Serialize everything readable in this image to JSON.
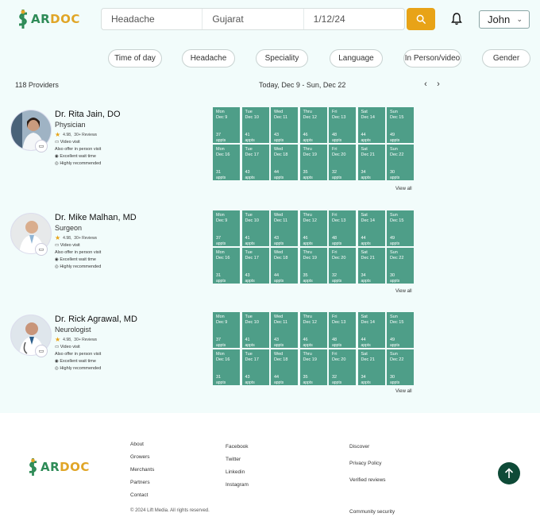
{
  "app": {
    "logo_text_part1": "S",
    "logo_text_part2": "AR",
    "logo_text_part3": "DOC",
    "brand_green": "#2e8b57",
    "brand_orange": "#e0a526"
  },
  "search": {
    "condition": "Headache",
    "location": "Gujarat",
    "date": "1/12/24",
    "button_color": "#e8a317"
  },
  "user": {
    "name": "John"
  },
  "filters": [
    "Time of day",
    "Headache",
    "Speciality",
    "Language",
    "In Person/video",
    "Gender"
  ],
  "results": {
    "count": "118 Providers",
    "date_range": "Today, Dec 9 - Sun, Dec 22",
    "prev": "‹",
    "next": "›"
  },
  "schedule": {
    "week1": [
      {
        "day": "Mon",
        "date": "Dec 9",
        "count": "37",
        "unit": "appts"
      },
      {
        "day": "Tue",
        "date": "Dec 10",
        "count": "41",
        "unit": "appts"
      },
      {
        "day": "Wed",
        "date": "Dec 11",
        "count": "43",
        "unit": "appts"
      },
      {
        "day": "Thru",
        "date": "Dec 12",
        "count": "46",
        "unit": "appts"
      },
      {
        "day": "Fri",
        "date": "Dec 13",
        "count": "48",
        "unit": "appts"
      },
      {
        "day": "Sat",
        "date": "Dec 14",
        "count": "44",
        "unit": "appts"
      },
      {
        "day": "Sun",
        "date": "Dec 15",
        "count": "49",
        "unit": "appts"
      }
    ],
    "week2": [
      {
        "day": "Mon",
        "date": "Dec 16",
        "count": "31",
        "unit": "appts"
      },
      {
        "day": "Tue",
        "date": "Dec 17",
        "count": "43",
        "unit": "appts"
      },
      {
        "day": "Wed",
        "date": "Dec 18",
        "count": "44",
        "unit": "appts"
      },
      {
        "day": "Thru",
        "date": "Dec 19",
        "count": "35",
        "unit": "appts"
      },
      {
        "day": "Fri",
        "date": "Dec 20",
        "count": "32",
        "unit": "appts"
      },
      {
        "day": "Sat",
        "date": "Dec 21",
        "count": "34",
        "unit": "appts"
      },
      {
        "day": "Sun",
        "date": "Dec 22",
        "count": "30",
        "unit": "appts"
      }
    ],
    "cell_color": "#4e9e88",
    "view_all": "View all"
  },
  "providers": [
    {
      "name": "Dr. Rita Jain, DO",
      "specialty": "Physician",
      "rating": "4.98,",
      "reviews": "30+ Reviews",
      "video": "Video visit",
      "in_person": "Also offer in person visit",
      "wait": "Excellent wait time",
      "recommended": "Highly recommended"
    },
    {
      "name": "Dr. Mike Malhan, MD",
      "specialty": "Surgeon",
      "rating": "4.98,",
      "reviews": "30+ Reviews",
      "video": "Video visit",
      "in_person": "Also offer in person visit",
      "wait": "Excellent wait time",
      "recommended": "Highly recommended"
    },
    {
      "name": "Dr. Rick Agrawal, MD",
      "specialty": "Neurologist",
      "rating": "4.98,",
      "reviews": "30+ Reviews",
      "video": "Video visit",
      "in_person": "Also offer in person visit",
      "wait": "Excellent wait time",
      "recommended": "Highly recommended"
    }
  ],
  "footer": {
    "col1": [
      "About",
      "Growers",
      "Merchants",
      "Partners",
      "Contact"
    ],
    "col2": [
      "Facebook",
      "Twitter",
      "Linkedin",
      "Instagram"
    ],
    "col3": [
      "Discover",
      "Privacy Policy",
      "Verified reviews",
      "Community security"
    ],
    "copyright": "© 2024 Lift Media. All rights reserved.",
    "totop_color": "#0e4a37"
  }
}
